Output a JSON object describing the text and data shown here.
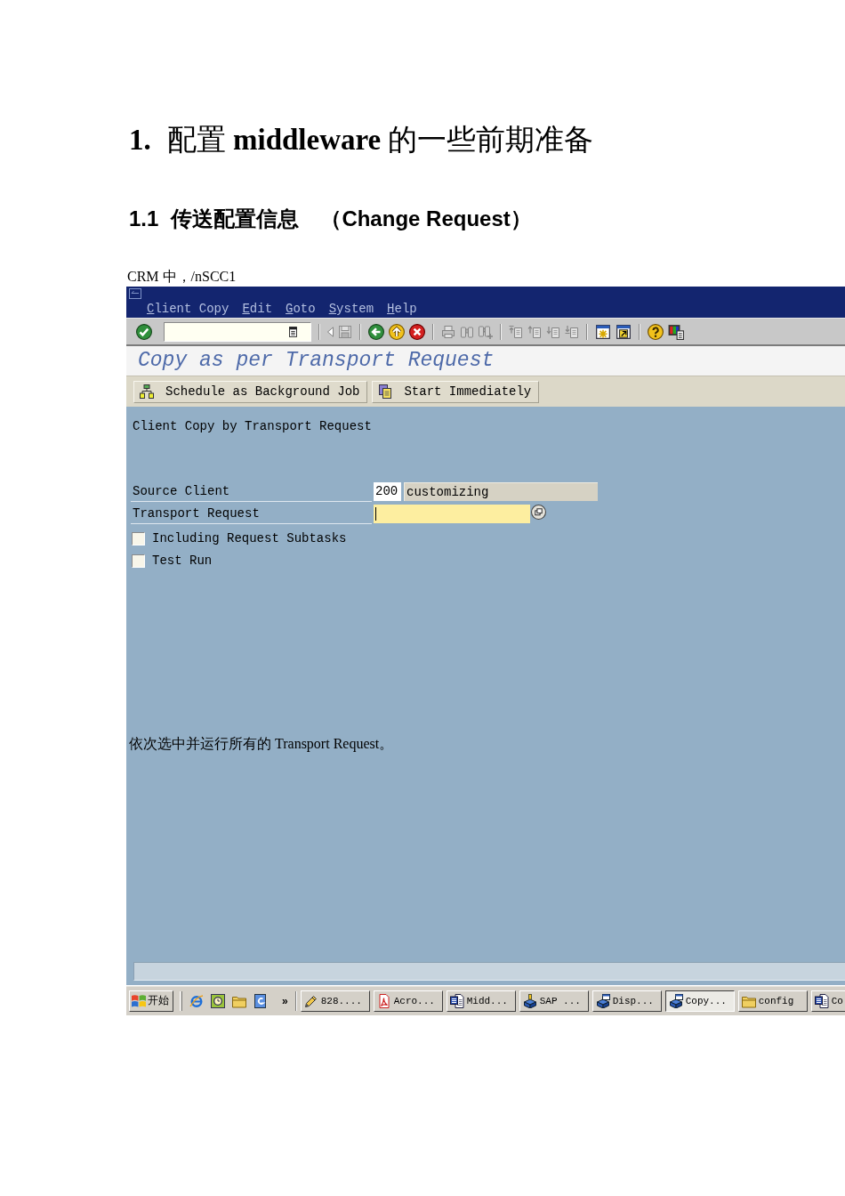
{
  "document": {
    "heading": {
      "number": "1.",
      "text": "配置 **middleware** 的一些前期准备"
    },
    "subheading": {
      "number": "1.1",
      "text": "传送配置信息　（Change Request）"
    },
    "intro": "CRM 中，/nSCC1"
  },
  "sap_window": {
    "menu": [
      "Client Copy",
      "Edit",
      "Goto",
      "System",
      "Help"
    ],
    "toolbar": [
      {
        "buttons": [
          {
            "kind": "enter",
            "disabled": false
          },
          {
            "kind": "command",
            "disabled": false
          }
        ]
      },
      {
        "buttons": [
          {
            "kind": "toggle",
            "disabled": false
          },
          {
            "kind": "save",
            "disabled": true
          }
        ]
      },
      {
        "buttons": [
          {
            "kind": "back",
            "disabled": false
          },
          {
            "kind": "exit",
            "disabled": false
          },
          {
            "kind": "cancel",
            "disabled": false
          }
        ]
      },
      {
        "buttons": [
          {
            "kind": "print",
            "disabled": true
          },
          {
            "kind": "find",
            "disabled": true
          },
          {
            "kind": "findnext",
            "disabled": true
          }
        ]
      },
      {
        "buttons": [
          {
            "kind": "first",
            "disabled": true
          },
          {
            "kind": "previous",
            "disabled": true
          },
          {
            "kind": "next",
            "disabled": true
          },
          {
            "kind": "last",
            "disabled": true
          }
        ]
      },
      {
        "buttons": [
          {
            "kind": "session",
            "disabled": false
          },
          {
            "kind": "shortcut",
            "disabled": false
          }
        ]
      },
      {
        "buttons": [
          {
            "kind": "help",
            "disabled": false
          },
          {
            "kind": "layout",
            "disabled": false
          }
        ]
      }
    ],
    "title": "Copy as per Transport Request",
    "app_toolbar": [
      {
        "kind": "schedule",
        "label": "Schedule as Background Job"
      },
      {
        "kind": "start",
        "label": "Start Immediately"
      }
    ],
    "screen": {
      "heading": "Client Copy by Transport Request",
      "fields": [
        {
          "kind": "display",
          "label": "Source Client",
          "value": "200",
          "description": "customizing",
          "focused": false
        },
        {
          "kind": "input",
          "label": "Transport Request",
          "focused": true
        }
      ],
      "checkboxes": [
        {
          "label": "Including Request Subtasks",
          "checked": false
        },
        {
          "label": "Test Run",
          "checked": false
        }
      ],
      "note": "依次选中并运行所有的 Transport Request。"
    },
    "taskbar": {
      "start": "开始",
      "more": "»",
      "tasks": [
        {
          "kind": "tool",
          "label": "828....",
          "selected": false
        },
        {
          "kind": "pdf",
          "label": "Acro...",
          "selected": false
        },
        {
          "kind": "word",
          "label": "Midd...",
          "selected": false
        },
        {
          "kind": "logon",
          "label": "SAP ...",
          "selected": false
        },
        {
          "kind": "gui",
          "label": "Disp...",
          "selected": false
        },
        {
          "kind": "gui",
          "label": "Copy...",
          "selected": true
        },
        {
          "kind": "folder",
          "label": "config",
          "selected": false
        },
        {
          "kind": "word",
          "label": "Co",
          "selected": false
        }
      ]
    }
  }
}
